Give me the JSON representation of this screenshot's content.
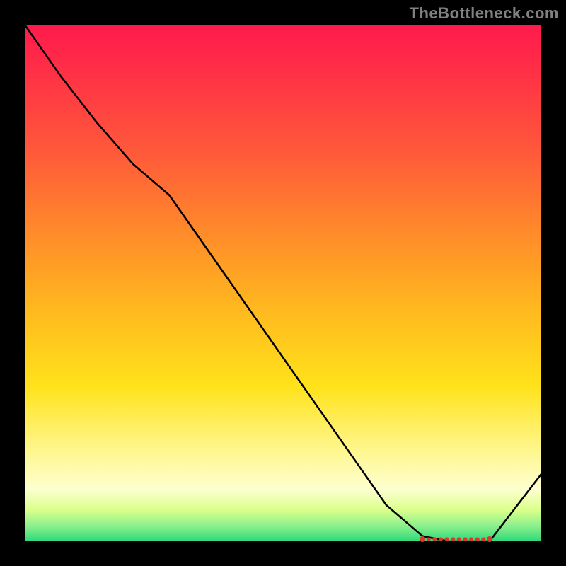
{
  "attribution": "TheBottleneck.com",
  "chart_data": {
    "type": "line",
    "x": [
      0.0,
      0.07,
      0.14,
      0.21,
      0.28,
      0.35,
      0.42,
      0.49,
      0.56,
      0.63,
      0.7,
      0.77,
      0.82,
      0.86,
      0.9,
      1.0
    ],
    "values": [
      100,
      90,
      81,
      73,
      67,
      57,
      47,
      37,
      27,
      17,
      7,
      1,
      0,
      0,
      0,
      13
    ],
    "title": "",
    "xlabel": "",
    "ylabel": "",
    "ylim": [
      0,
      100
    ],
    "xlim": [
      0,
      1
    ],
    "flat_region": {
      "x_start": 0.77,
      "x_end": 0.9,
      "y": 0,
      "marker_color": "#d83a2a",
      "dots": 12
    },
    "line_color": "#000000",
    "line_width": 2.6
  }
}
